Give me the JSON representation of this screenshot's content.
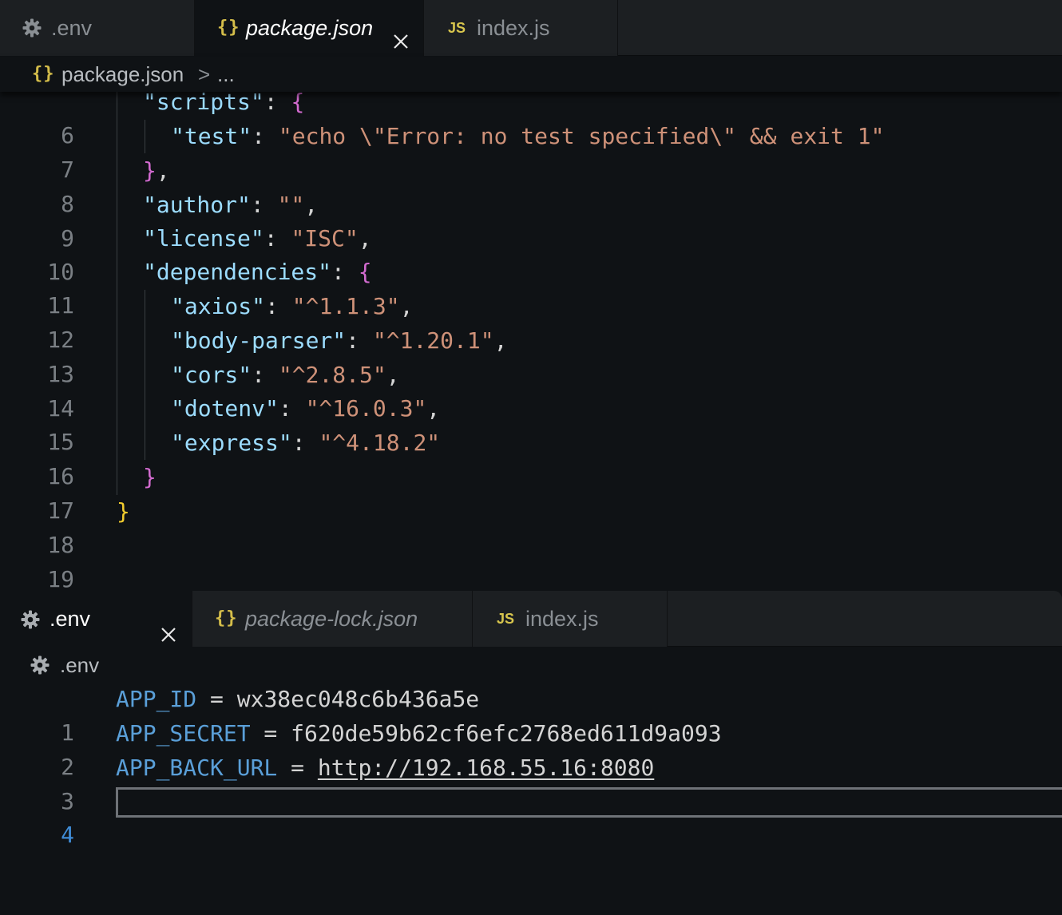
{
  "top_pane": {
    "tabs": [
      {
        "icon": "gear-icon",
        "label": ".env",
        "active": false
      },
      {
        "icon": "braces-icon",
        "glyph": "{}",
        "label": "package.json",
        "active": true,
        "italic": true
      },
      {
        "icon": "js-icon",
        "glyph": "JS",
        "label": "index.js",
        "active": false
      }
    ],
    "breadcrumb": {
      "glyph": "{}",
      "file": "package.json",
      "sep": ">",
      "rest": "..."
    },
    "lines": [
      {
        "n": "6"
      },
      {
        "n": "7"
      },
      {
        "n": "8"
      },
      {
        "n": "9"
      },
      {
        "n": "10"
      },
      {
        "n": "11"
      },
      {
        "n": "12"
      },
      {
        "n": "13"
      },
      {
        "n": "14"
      },
      {
        "n": "15"
      },
      {
        "n": "16"
      },
      {
        "n": "17"
      },
      {
        "n": "18"
      },
      {
        "n": "19"
      }
    ],
    "code": {
      "scripts_key": "\"scripts\"",
      "test_key": "\"test\"",
      "test_val": "\"echo \\\"Error: no test specified\\\" && exit 1\"",
      "author_key": "\"author\"",
      "author_val": "\"\"",
      "license_key": "\"license\"",
      "license_val": "\"ISC\"",
      "deps_key": "\"dependencies\"",
      "dependencies": [
        {
          "key": "\"axios\"",
          "val": "\"^1.1.3\"",
          "comma": ","
        },
        {
          "key": "\"body-parser\"",
          "val": "\"^1.20.1\"",
          "comma": ","
        },
        {
          "key": "\"cors\"",
          "val": "\"^2.8.5\"",
          "comma": ","
        },
        {
          "key": "\"dotenv\"",
          "val": "\"^16.0.3\"",
          "comma": ","
        },
        {
          "key": "\"express\"",
          "val": "\"^4.18.2\"",
          "comma": ""
        }
      ],
      "colon": ":",
      "comma": ",",
      "brace_open": "{",
      "brace_close": "}",
      "brace_close_comma": "},"
    }
  },
  "bottom_pane": {
    "tabs": [
      {
        "icon": "gear-icon",
        "label": ".env",
        "active": true
      },
      {
        "icon": "braces-icon",
        "glyph": "{}",
        "label": "package-lock.json",
        "active": false,
        "italic": true
      },
      {
        "icon": "js-icon",
        "glyph": "JS",
        "label": "index.js",
        "active": false
      }
    ],
    "breadcrumb": {
      "file": ".env"
    },
    "lines": [
      {
        "n": "1",
        "key": "APP_ID",
        "eq": " = ",
        "val": "wx38ec048c6b436a5e"
      },
      {
        "n": "2",
        "key": "APP_SECRET",
        "eq": " = ",
        "val": "f620de59b62cf6efc2768ed611d9a093"
      },
      {
        "n": "3",
        "key": "APP_BACK_URL",
        "eq": " = ",
        "val": "http://192.168.55.16:8080"
      },
      {
        "n": "4"
      }
    ]
  },
  "colors": {
    "background": "#0f1215",
    "tab_bar": "#1c1f22",
    "key": "#9cdcfe",
    "string": "#ce9178",
    "bracket_level1": "#f2cc2e",
    "bracket_level2": "#d36bd0",
    "env_key": "#5a9fd8",
    "line_number": "#7a7f84",
    "current_line_number": "#3f8cd6"
  }
}
